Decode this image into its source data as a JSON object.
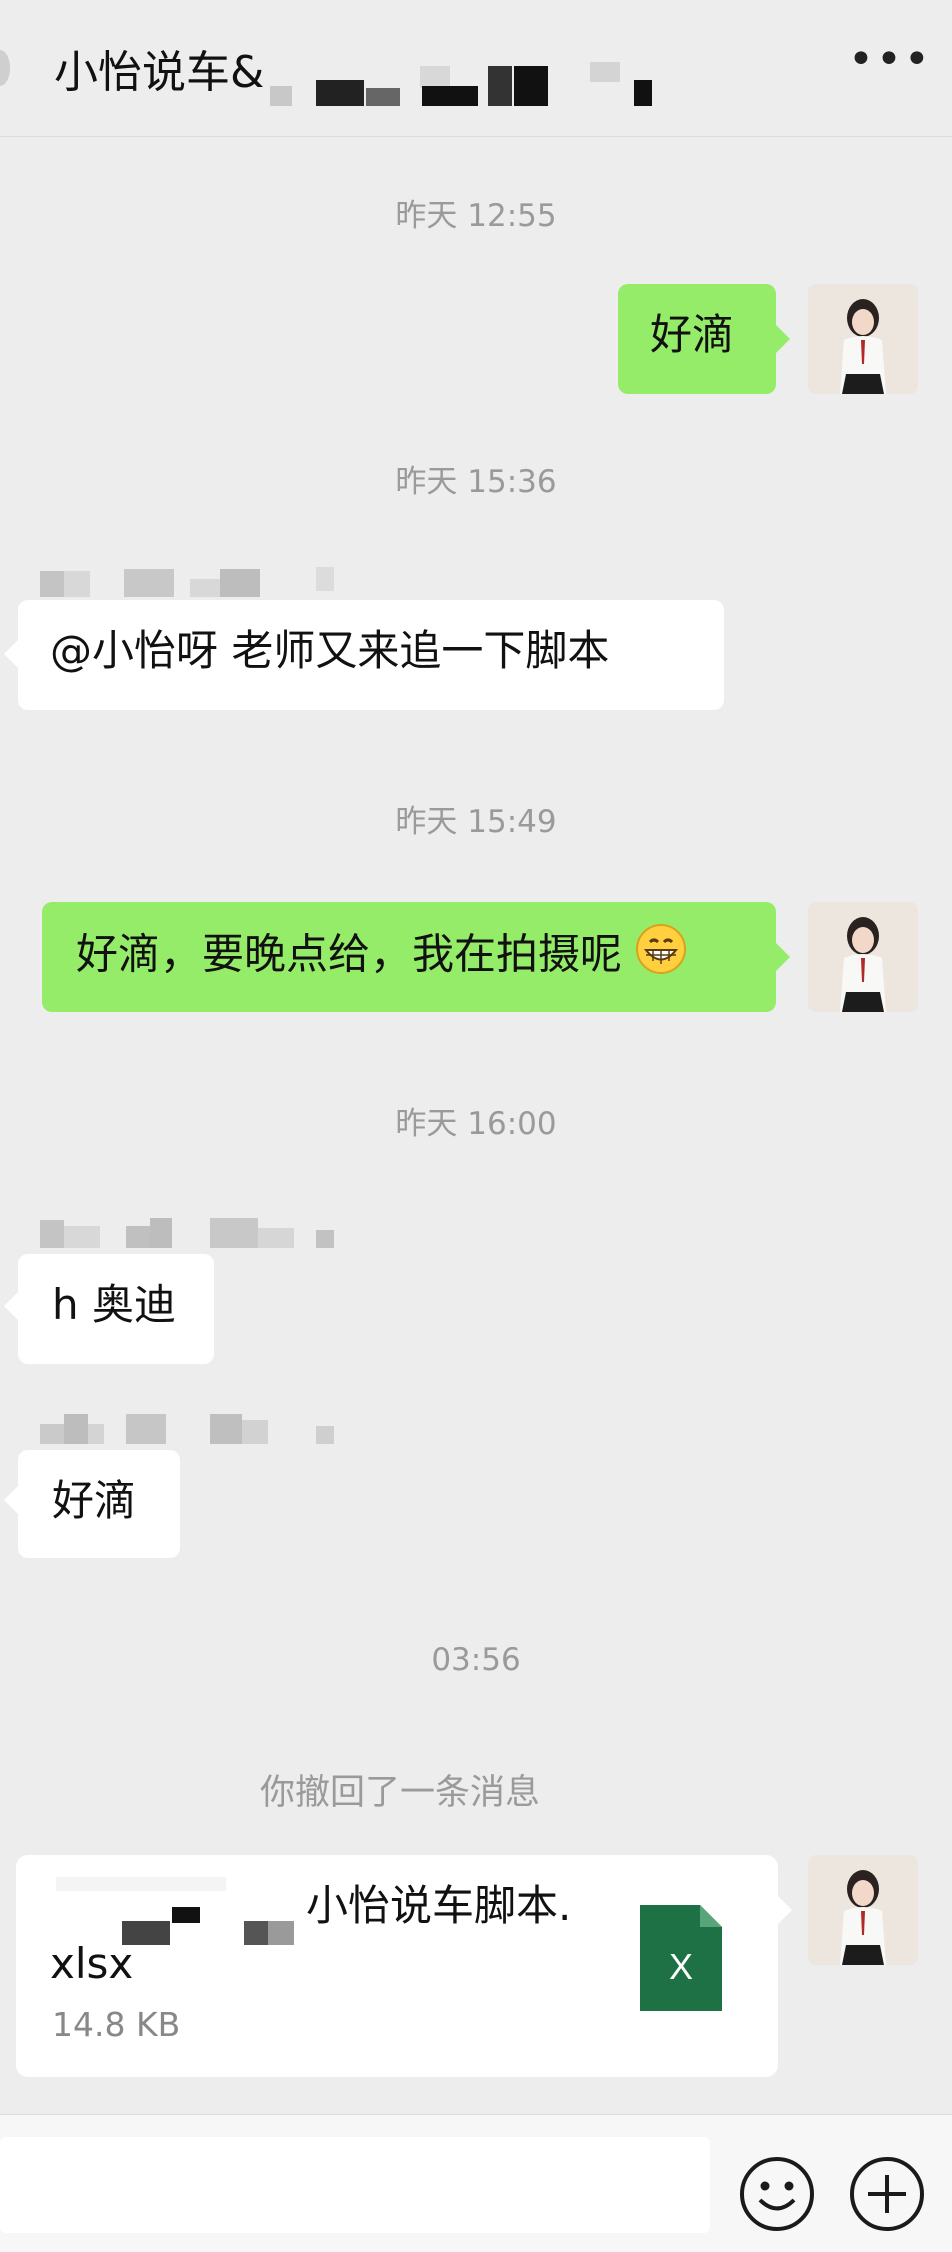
{
  "header": {
    "title": "小怡说车&"
  },
  "messages": {
    "t1": "昨天 12:55",
    "m1": "好滴",
    "t2": "昨天 15:36",
    "m2": "@小怡呀  老师又来追一下脚本",
    "t3": "昨天 15:49",
    "m3": "好滴，要晚点给，我在拍摄呢",
    "t4": "昨天 16:00",
    "m4": "h 奥迪",
    "m5": "好滴",
    "t5": "03:56",
    "recall": "你撤回了一条消息"
  },
  "file": {
    "name": "小怡说车脚本.",
    "ext": "xlsx",
    "size": "14.8 KB",
    "icon_letter": "X",
    "icon_name": "excel-file-icon"
  },
  "colors": {
    "sent_bubble": "#95ec69",
    "received_bubble": "#ffffff",
    "background": "#ededed",
    "excel_green": "#1e7145"
  }
}
